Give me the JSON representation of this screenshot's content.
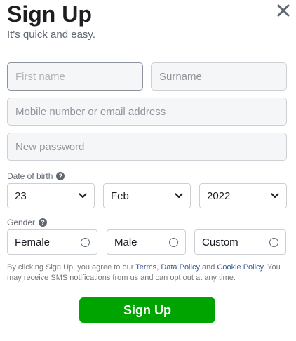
{
  "header": {
    "title": "Sign Up",
    "subtitle": "It's quick and easy.",
    "close_icon": "close-icon"
  },
  "form": {
    "first_name_placeholder": "First name",
    "surname_placeholder": "Surname",
    "contact_placeholder": "Mobile number or email address",
    "password_placeholder": "New password"
  },
  "dob": {
    "label": "Date of birth",
    "help": "?",
    "day": "23",
    "month": "Feb",
    "year": "2022"
  },
  "gender": {
    "label": "Gender",
    "help": "?",
    "options": [
      {
        "label": "Female",
        "selected": false
      },
      {
        "label": "Male",
        "selected": false
      },
      {
        "label": "Custom",
        "selected": false
      }
    ]
  },
  "legal": {
    "part1": "By clicking Sign Up, you agree to our ",
    "terms": "Terms",
    "sep1": ", ",
    "data_policy": "Data Policy",
    "sep2": " and ",
    "cookie_policy": "Cookie Policy",
    "part2": ". You may receive SMS notifications from us and can opt out at any time."
  },
  "submit_label": "Sign Up",
  "colors": {
    "primary_button": "#00a400",
    "link": "#385898",
    "text_secondary": "#606770"
  }
}
